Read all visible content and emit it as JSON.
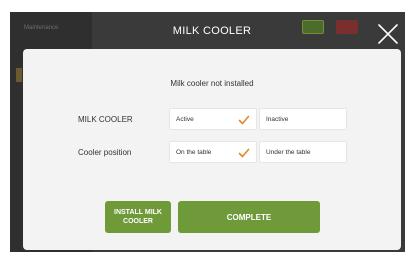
{
  "background": {
    "panel_label": "Maintenance"
  },
  "header": {
    "title": "MILK COOLER",
    "close_icon": "close-icon"
  },
  "dialog": {
    "status": "Milk cooler not installed",
    "rows": [
      {
        "label": "MILK COOLER",
        "options": [
          {
            "label": "Active",
            "selected": true
          },
          {
            "label": "Inactive",
            "selected": false
          }
        ]
      },
      {
        "label": "Cooler position",
        "options": [
          {
            "label": "On the table",
            "selected": true
          },
          {
            "label": "Under the table",
            "selected": false
          }
        ]
      }
    ],
    "install_button": "INSTALL MILK COOLER",
    "complete_button": "COMPLETE"
  },
  "colors": {
    "accent": "#6e9a3a",
    "check": "#e8842a",
    "overlay": "#3a3a3a",
    "dialog_bg": "#f3f3f3"
  }
}
